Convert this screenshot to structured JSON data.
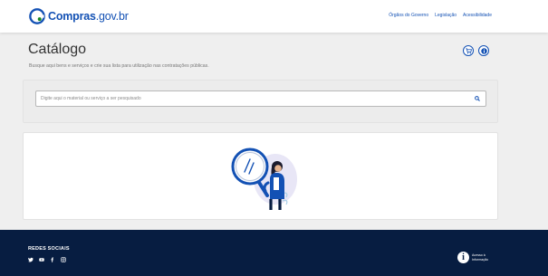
{
  "header": {
    "logo_text": "Compras",
    "logo_domain": ".gov.br",
    "nav": [
      "Órgãos do Governo",
      "Legislação",
      "Acessibilidade"
    ]
  },
  "page": {
    "title": "Catálogo",
    "subtitle": "Busque aqui bens e serviços e crie sua lista para utilização nas contratações públicas."
  },
  "search": {
    "placeholder": "Digite aqui o material ou serviço a ser pesquisado",
    "value": ""
  },
  "icons": {
    "cart": "cart-icon",
    "info": "info-icon",
    "search": "search-icon"
  },
  "footer": {
    "socials_title": "REDES SOCIAIS",
    "socials": [
      "twitter-icon",
      "youtube-icon",
      "facebook-icon",
      "instagram-icon"
    ],
    "lai_line1": "Acesso à",
    "lai_line2": "Informação"
  },
  "colors": {
    "brand_blue": "#1351b4",
    "footer_navy": "#071d41",
    "background": "#efefef"
  }
}
